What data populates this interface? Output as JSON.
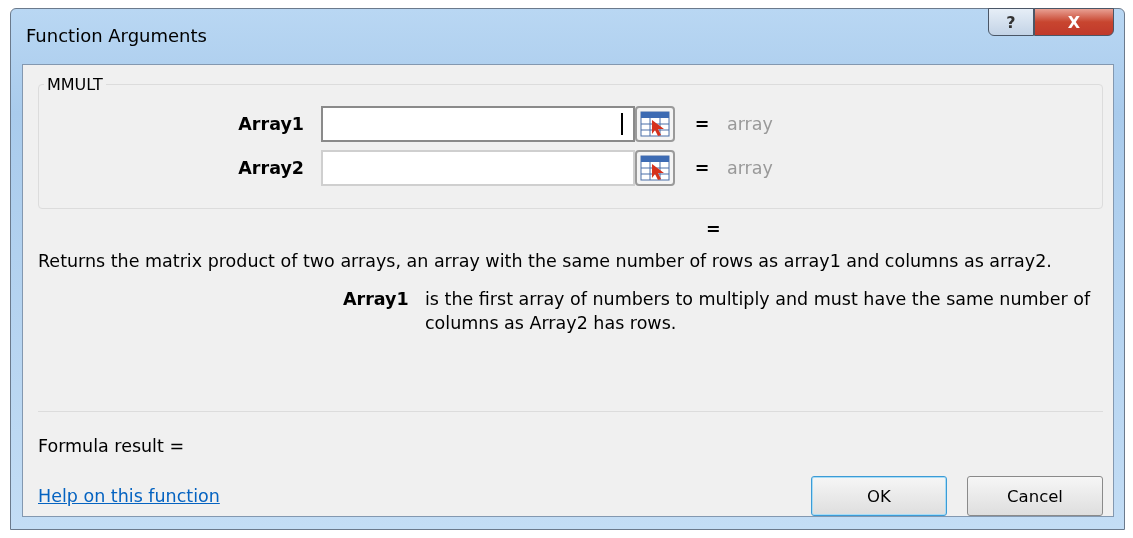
{
  "window": {
    "title": "Function Arguments",
    "buttons": [
      {
        "kind": "help",
        "label": "?"
      },
      {
        "kind": "close",
        "label": "X"
      }
    ]
  },
  "function_name": "MMULT",
  "arguments": [
    {
      "label": "Array1",
      "focused": true,
      "equals": "=",
      "result": "array"
    },
    {
      "label": "Array2",
      "focused": false,
      "equals": "=",
      "result": "array"
    }
  ],
  "overall_result": "=",
  "description": "Returns the matrix product of two arrays, an array with the same number of rows as array1 and columns as array2.",
  "argument_help": {
    "name": "Array1",
    "text": "is the first array of numbers to multiply and must have the same number of columns as Array2 has rows."
  },
  "formula_result": "Formula result =",
  "help_link": "Help on this function",
  "buttons": [
    {
      "label": "OK",
      "default": true
    },
    {
      "label": "Cancel",
      "default": false
    }
  ]
}
